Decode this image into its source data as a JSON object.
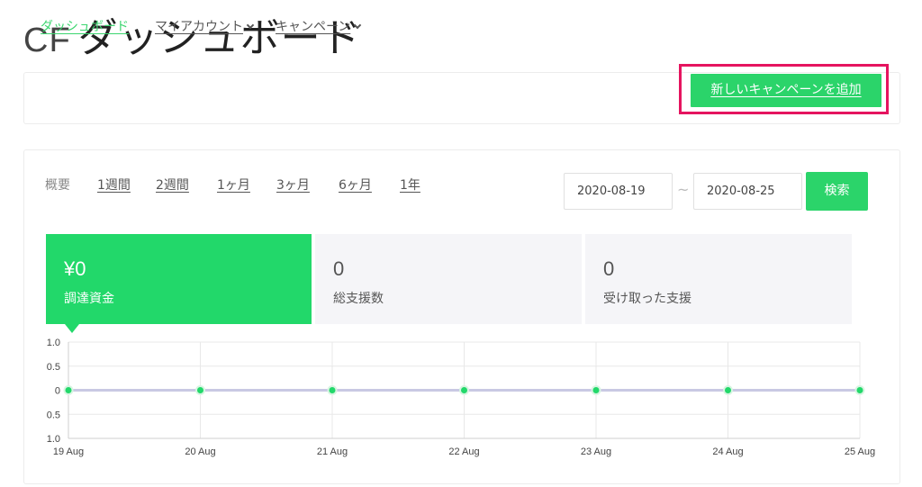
{
  "header": {
    "title_prefix": "CF",
    "title": "ダッシュボード"
  },
  "nav": {
    "items": [
      {
        "label": "ダッシュボード",
        "active": true,
        "dropdown": false
      },
      {
        "label": "マイアカウント",
        "active": false,
        "dropdown": true
      },
      {
        "label": "キャンペーン",
        "active": false,
        "dropdown": true
      }
    ],
    "add_campaign_label": "新しいキャンペーンを追加"
  },
  "filters": {
    "summary_label": "概要",
    "periods": [
      "1週間",
      "2週間",
      "1ヶ月",
      "3ヶ月",
      "6ヶ月",
      "1年"
    ],
    "date_from": "2020-08-19",
    "date_separator": "~",
    "date_to": "2020-08-25",
    "search_label": "検索"
  },
  "stats": [
    {
      "value": "¥0",
      "label": "調達資金",
      "active": true
    },
    {
      "value": "0",
      "label": "総支援数",
      "active": false
    },
    {
      "value": "0",
      "label": "受け取った支援",
      "active": false
    }
  ],
  "colors": {
    "accent": "#2bd46a",
    "highlight_outline": "#e5145f",
    "card_bg": "#f5f5f8"
  },
  "chart_data": {
    "type": "line",
    "x": [
      "19 Aug",
      "20 Aug",
      "21 Aug",
      "22 Aug",
      "23 Aug",
      "24 Aug",
      "25 Aug"
    ],
    "y_tick_labels": [
      "1.0",
      "0.5",
      "0",
      "0.5",
      "1.0"
    ],
    "series": [
      {
        "values": [
          0,
          0,
          0,
          0,
          0,
          0,
          0
        ]
      }
    ],
    "ylim": [
      -1,
      1
    ],
    "grid": true
  }
}
